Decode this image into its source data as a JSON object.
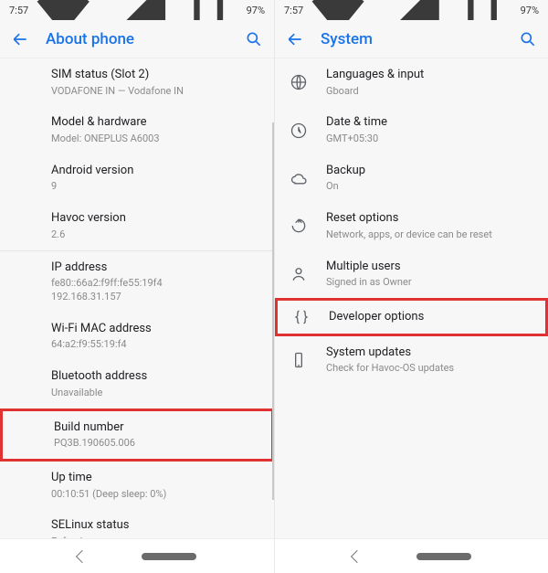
{
  "status": {
    "time": "7:57",
    "battery": "97%"
  },
  "left": {
    "title": "About phone",
    "items": [
      {
        "primary": "SIM status (Slot 2)",
        "secondary": "VODAFONE IN — Vodafone IN"
      },
      {
        "primary": "Model & hardware",
        "secondary": "Model: ONEPLUS A6003"
      },
      {
        "primary": "Android version",
        "secondary": "9"
      },
      {
        "primary": "Havoc version",
        "secondary": "2.6"
      },
      {
        "primary": "IP address",
        "secondary": "fe80::66a2:f9ff:fe55:19f4\n192.168.31.157"
      },
      {
        "primary": "Wi-Fi MAC address",
        "secondary": "64:a2:f9:55:19:f4"
      },
      {
        "primary": "Bluetooth address",
        "secondary": "Unavailable"
      },
      {
        "primary": "Build number",
        "secondary": "PQ3B.190605.006"
      },
      {
        "primary": "Up time",
        "secondary": "00:10:51 (Deep sleep: 0%)"
      },
      {
        "primary": "SELinux status",
        "secondary": "Enforcing"
      }
    ],
    "highlightIndex": 7
  },
  "right": {
    "title": "System",
    "items": [
      {
        "icon": "globe-icon",
        "primary": "Languages & input",
        "secondary": "Gboard"
      },
      {
        "icon": "clock-icon",
        "primary": "Date & time",
        "secondary": "GMT+05:30"
      },
      {
        "icon": "cloud-icon",
        "primary": "Backup",
        "secondary": "On"
      },
      {
        "icon": "restore-icon",
        "primary": "Reset options",
        "secondary": "Network, apps, or device can be reset"
      },
      {
        "icon": "person-icon",
        "primary": "Multiple users",
        "secondary": "Signed in as Owner"
      },
      {
        "icon": "braces-icon",
        "primary": "Developer options",
        "secondary": ""
      },
      {
        "icon": "device-icon",
        "primary": "System updates",
        "secondary": "Check for Havoc-OS updates"
      }
    ],
    "highlightIndex": 5
  }
}
